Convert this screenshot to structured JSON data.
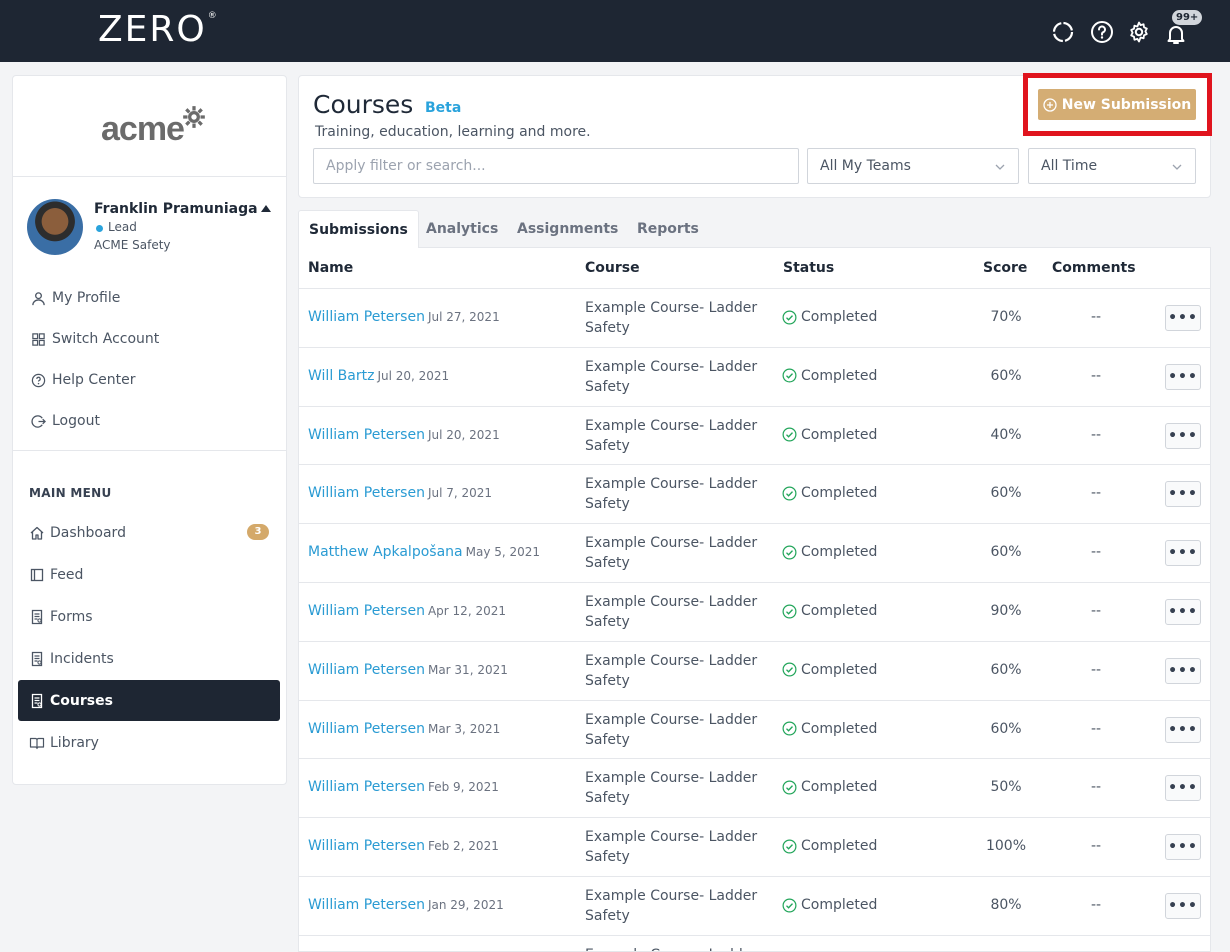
{
  "app": {
    "logo": "ZERO",
    "logo_mark": "®",
    "notifications_badge": "99+"
  },
  "sidebar": {
    "org_logo": "acme",
    "user": {
      "name": "Franklin Pramuniaga",
      "role": "Lead",
      "org": "ACME Safety"
    },
    "account_items": [
      {
        "label": "My Profile",
        "icon": "user-icon"
      },
      {
        "label": "Switch Account",
        "icon": "grid-icon"
      },
      {
        "label": "Help Center",
        "icon": "help-icon"
      },
      {
        "label": "Logout",
        "icon": "logout-icon"
      }
    ],
    "menu_title": "MAIN MENU",
    "menu_items": [
      {
        "label": "Dashboard",
        "icon": "home-icon",
        "badge": "3"
      },
      {
        "label": "Feed",
        "icon": "feed-icon"
      },
      {
        "label": "Forms",
        "icon": "form-icon"
      },
      {
        "label": "Incidents",
        "icon": "incident-icon"
      },
      {
        "label": "Courses",
        "icon": "course-icon",
        "active": true
      },
      {
        "label": "Library",
        "icon": "book-icon"
      }
    ]
  },
  "header": {
    "title": "Courses",
    "beta": "Beta",
    "subtitle": "Training, education, learning and more.",
    "search_placeholder": "Apply filter or search...",
    "team_filter": "All My Teams",
    "time_filter": "All Time",
    "new_submission_label": "New Submission"
  },
  "tabs": [
    "Submissions",
    "Analytics",
    "Assignments",
    "Reports"
  ],
  "table": {
    "headers": {
      "name": "Name",
      "course": "Course",
      "status": "Status",
      "score": "Score",
      "comments": "Comments"
    },
    "rows": [
      {
        "name": "William Petersen",
        "date": "Jul 27, 2021",
        "course": "Example Course- Ladder Safety",
        "status": "Completed",
        "score": "70%",
        "comments": "--"
      },
      {
        "name": "Will Bartz",
        "date": "Jul 20, 2021",
        "course": "Example Course- Ladder Safety",
        "status": "Completed",
        "score": "60%",
        "comments": "--"
      },
      {
        "name": "William Petersen",
        "date": "Jul 20, 2021",
        "course": "Example Course- Ladder Safety",
        "status": "Completed",
        "score": "40%",
        "comments": "--"
      },
      {
        "name": "William Petersen",
        "date": "Jul 7, 2021",
        "course": "Example Course- Ladder Safety",
        "status": "Completed",
        "score": "60%",
        "comments": "--"
      },
      {
        "name": "Matthew Apkalpošana",
        "date": "May 5, 2021",
        "course": "Example Course- Ladder Safety",
        "status": "Completed",
        "score": "60%",
        "comments": "--"
      },
      {
        "name": "William Petersen",
        "date": "Apr 12, 2021",
        "course": "Example Course- Ladder Safety",
        "status": "Completed",
        "score": "90%",
        "comments": "--"
      },
      {
        "name": "William Petersen",
        "date": "Mar 31, 2021",
        "course": "Example Course- Ladder Safety",
        "status": "Completed",
        "score": "60%",
        "comments": "--"
      },
      {
        "name": "William Petersen",
        "date": "Mar 3, 2021",
        "course": "Example Course- Ladder Safety",
        "status": "Completed",
        "score": "60%",
        "comments": "--"
      },
      {
        "name": "William Petersen",
        "date": "Feb 9, 2021",
        "course": "Example Course- Ladder Safety",
        "status": "Completed",
        "score": "50%",
        "comments": "--"
      },
      {
        "name": "William Petersen",
        "date": "Feb 2, 2021",
        "course": "Example Course- Ladder Safety",
        "status": "Completed",
        "score": "100%",
        "comments": "--"
      },
      {
        "name": "William Petersen",
        "date": "Jan 29, 2021",
        "course": "Example Course- Ladder Safety",
        "status": "Completed",
        "score": "80%",
        "comments": "--"
      },
      {
        "name": "",
        "date": "",
        "course": "Example Course- Ladder",
        "status": "",
        "score": "",
        "comments": ""
      }
    ]
  },
  "colors": {
    "topbar": "#1e2633",
    "link": "#2a9bd3",
    "accent_button": "#d4ad74",
    "highlight": "#e0141e",
    "status_ok": "#22a55a"
  }
}
